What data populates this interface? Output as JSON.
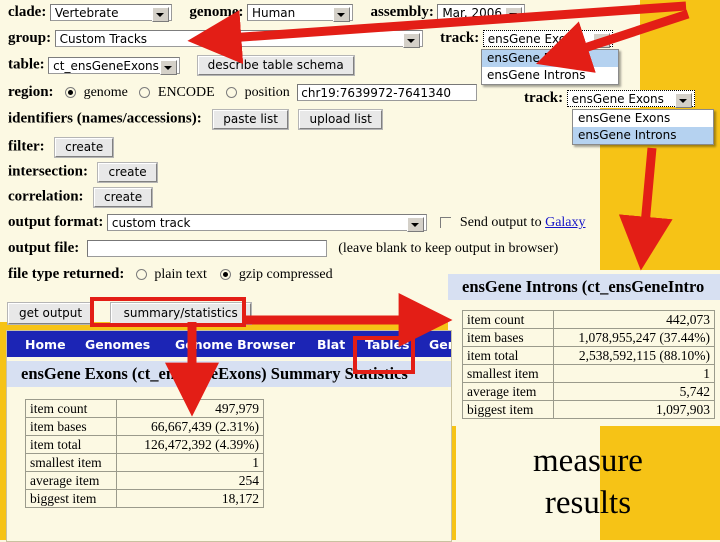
{
  "form": {
    "clade": {
      "label": "clade:",
      "value": "Vertebrate"
    },
    "genome": {
      "label": "genome:",
      "value": "Human"
    },
    "assembly": {
      "label": "assembly:",
      "value": "Mar. 2006"
    },
    "group": {
      "label": "group:",
      "value": "Custom Tracks"
    },
    "track_top": {
      "label": "track:",
      "value": "ensGene Exons"
    },
    "table": {
      "label": "table:",
      "value": "ct_ensGeneExons"
    },
    "describe_schema": "describe table schema",
    "region": {
      "label": "region:",
      "genome_option": "genome",
      "encode_option": "ENCODE",
      "position_option": "position",
      "position_value": "chr19:7639972-7641340"
    },
    "track_bottom": {
      "label": "track:",
      "value": "ensGene Exons"
    },
    "identifiers": {
      "label": "identifiers (names/accessions):",
      "paste": "paste list",
      "upload": "upload list"
    },
    "filter": {
      "label": "filter:",
      "button": "create"
    },
    "intersection": {
      "label": "intersection:",
      "button": "create"
    },
    "correlation": {
      "label": "correlation:",
      "button": "create"
    },
    "output_format": {
      "label": "output format:",
      "value": "custom track"
    },
    "galaxy": {
      "text": "Send output to",
      "link": "Galaxy"
    },
    "output_file": {
      "label": "output file:",
      "value": "",
      "hint": "(leave blank to keep output in browser)"
    },
    "file_type": {
      "label": "file type returned:",
      "plain": "plain text",
      "gzip": "gzip compressed"
    },
    "get_output": "get output",
    "summary_statistics": "summary/statistics"
  },
  "dropdown_top": {
    "options": [
      "ensGene Exons",
      "ensGene Introns"
    ],
    "selected": "ensGene Exons"
  },
  "dropdown_bottom": {
    "options": [
      "ensGene Exons",
      "ensGene Introns"
    ],
    "selected": "ensGene Introns"
  },
  "navbar": {
    "items": [
      "Home",
      "Genomes",
      "Genome Browser",
      "Blat",
      "Tables",
      "Gen"
    ]
  },
  "exons_panel": {
    "title": "ensGene Exons (ct_ensGeneExons) Summary Statistics",
    "rows": [
      {
        "key": "item count",
        "value": "497,979"
      },
      {
        "key": "item bases",
        "value": "66,667,439 (2.31%)"
      },
      {
        "key": "item total",
        "value": "126,472,392 (4.39%)"
      },
      {
        "key": "smallest item",
        "value": "1"
      },
      {
        "key": "average item",
        "value": "254"
      },
      {
        "key": "biggest item",
        "value": "18,172"
      }
    ]
  },
  "introns_panel": {
    "title": "ensGene Introns (ct_ensGeneIntro",
    "rows": [
      {
        "key": "item count",
        "value": "442,073"
      },
      {
        "key": "item bases",
        "value": "1,078,955,247 (37.44%)"
      },
      {
        "key": "item total",
        "value": "2,538,592,115 (88.10%)"
      },
      {
        "key": "smallest item",
        "value": "1"
      },
      {
        "key": "average item",
        "value": "5,742"
      },
      {
        "key": "biggest item",
        "value": "1,097,903"
      }
    ]
  },
  "annotation": {
    "measure_line1": "measure",
    "measure_line2": "results",
    "arrow_color": "#e31e16",
    "accent_yellow": "#f6c316",
    "nav_blue": "#1c25b5"
  }
}
